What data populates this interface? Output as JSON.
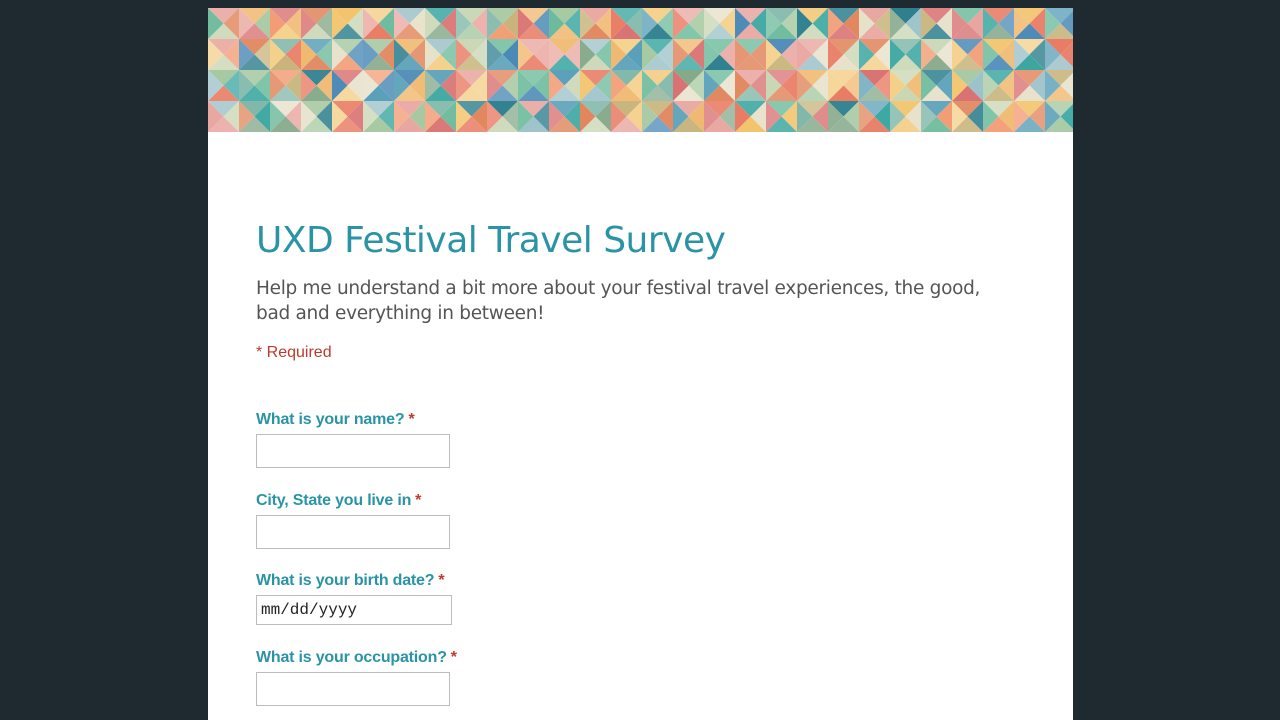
{
  "form": {
    "title": "UXD Festival Travel Survey",
    "description": "Help me understand a bit more about your festival travel experiences, the good, bad and everything in between!",
    "required_note": "* Required",
    "required_marker": "*"
  },
  "questions": [
    {
      "label": "What is your name?",
      "value": ""
    },
    {
      "label": "City, State you live in",
      "value": ""
    },
    {
      "label": "What is your birth date?",
      "placeholder": "mm/dd/yyyy",
      "value": ""
    },
    {
      "label": "What is your occupation?",
      "value": ""
    }
  ],
  "colors": {
    "page_background": "#1f2a30",
    "accent": "#2a94a6",
    "required": "#c0392b",
    "body_text": "#555555"
  }
}
